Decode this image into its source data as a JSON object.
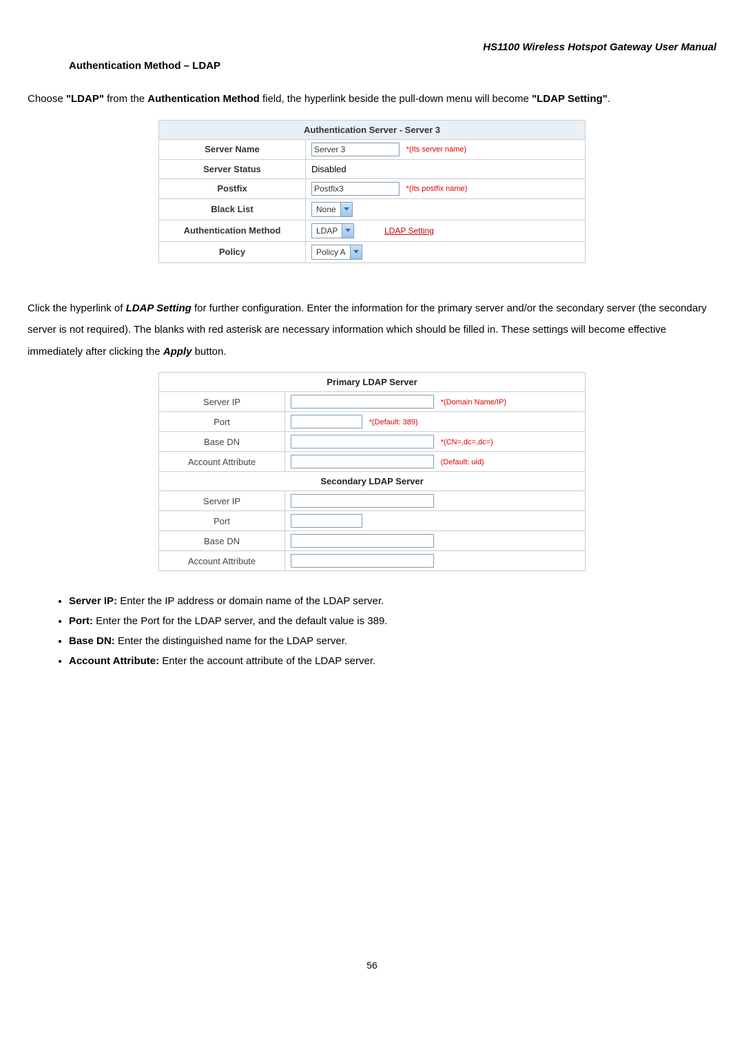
{
  "header": {
    "title": "HS1100  Wireless  Hotspot  Gateway  User  Manual"
  },
  "section_title": "Authentication Method – LDAP",
  "intro": {
    "prefix": "Choose ",
    "ldap_quoted": "\"LDAP\"",
    "mid1": " from the ",
    "auth_method": "Authentication Method",
    "mid2": " field, the hyperlink beside the pull-down menu will become ",
    "ldap_setting_quoted": "\"LDAP Setting\"",
    "suffix": "."
  },
  "auth_table": {
    "caption": "Authentication Server - Server 3",
    "rows": {
      "server_name": {
        "label": "Server Name",
        "value": "Server 3",
        "hint": "*(Its server name)"
      },
      "server_status": {
        "label": "Server Status",
        "value": "Disabled"
      },
      "postfix": {
        "label": "Postfix",
        "value": "Postfix3",
        "hint": "*(Its postfix name)"
      },
      "black_list": {
        "label": "Black List",
        "selected": "None"
      },
      "auth_method": {
        "label": "Authentication Method",
        "selected": "LDAP",
        "link": "LDAP Setting"
      },
      "policy": {
        "label": "Policy",
        "selected": "Policy A"
      }
    }
  },
  "para2": {
    "prefix": "Click the hyperlink of ",
    "ldap_setting": "LDAP Setting",
    "mid": " for further configuration. Enter the information for the primary server and/or the secondary server (the secondary server is not required). The blanks with red asterisk are necessary information which should be filled in. These settings will become effective immediately after clicking the ",
    "apply": "Apply",
    "suffix": " button."
  },
  "ldap_table": {
    "primary_caption": "Primary LDAP Server",
    "secondary_caption": "Secondary LDAP Server",
    "rows": {
      "server_ip": {
        "label": "Server IP",
        "hint": "*(Domain Name/IP)"
      },
      "port": {
        "label": "Port",
        "hint": "*(Default: 389)"
      },
      "base_dn": {
        "label": "Base DN",
        "hint": "*(CN=,dc=,dc=)"
      },
      "account_attr": {
        "label": "Account Attribute",
        "hint": "(Default: uid)"
      }
    }
  },
  "bullets": {
    "server_ip": {
      "term": "Server IP:",
      "desc": " Enter the IP address or domain name of the LDAP server."
    },
    "port": {
      "term": "Port:",
      "desc": " Enter the Port for the LDAP server, and the default value is 389."
    },
    "base_dn": {
      "term": "Base DN:",
      "desc": " Enter the distinguished name for the LDAP server."
    },
    "account_attr": {
      "term": "Account Attribute:",
      "desc": " Enter the account attribute of the LDAP server."
    }
  },
  "footer": {
    "page": "56"
  }
}
